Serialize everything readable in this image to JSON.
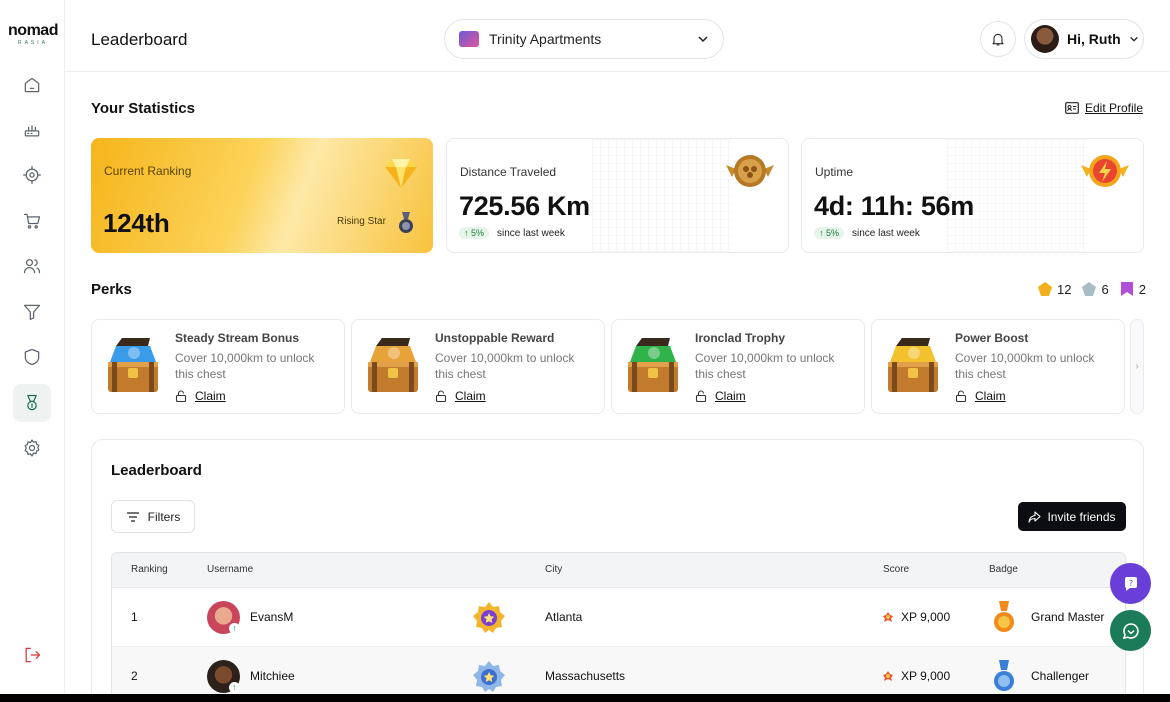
{
  "brand": {
    "logo_text": "nomad",
    "logo_sub": "RASIA"
  },
  "sidebar": {
    "items": [
      {
        "icon": "home-icon"
      },
      {
        "icon": "router-icon"
      },
      {
        "icon": "target-icon"
      },
      {
        "icon": "cart-icon"
      },
      {
        "icon": "users-icon"
      },
      {
        "icon": "funnel-icon"
      },
      {
        "icon": "shield-icon"
      },
      {
        "icon": "medal-icon",
        "active": true
      },
      {
        "icon": "gear-icon"
      }
    ],
    "logout_icon": "logout-icon"
  },
  "header": {
    "title": "Leaderboard",
    "property_name": "Trinity Apartments",
    "greeting": "Hi, Ruth"
  },
  "statistics": {
    "title": "Your Statistics",
    "edit_profile": "Edit Profile",
    "ranking": {
      "label": "Current Ranking",
      "value": "124th",
      "tier": "Rising Star"
    },
    "distance": {
      "label": "Distance Traveled",
      "value": "725.56 Km",
      "change": "↑ 5%",
      "since": "since last week"
    },
    "uptime": {
      "label": "Uptime",
      "value": "4d: 11h: 56m",
      "change": "↑ 5%",
      "since": "since last week"
    }
  },
  "perks": {
    "title": "Perks",
    "counts": {
      "gold": "12",
      "silver": "6",
      "purple": "2"
    },
    "items": [
      {
        "title": "Steady Stream Bonus",
        "desc": "Cover 10,000km to unlock this chest",
        "action": "Claim",
        "gem_color": "#3a9be8"
      },
      {
        "title": "Unstoppable Reward",
        "desc": "Cover 10,000km to unlock this chest",
        "action": "Claim",
        "gem_color": "#e8a23a"
      },
      {
        "title": "Ironclad Trophy",
        "desc": "Cover 10,000km to unlock this chest",
        "action": "Claim",
        "gem_color": "#2fb34a"
      },
      {
        "title": "Power Boost",
        "desc": "Cover 10,000km to unlock this chest",
        "action": "Claim",
        "gem_color": "#f2c12e"
      }
    ]
  },
  "leaderboard": {
    "title": "Leaderboard",
    "filters_label": "Filters",
    "invite_label": "Invite friends",
    "columns": [
      "Ranking",
      "Username",
      "City",
      "Score",
      "Badge"
    ],
    "rows": [
      {
        "rank": "1",
        "username": "EvansM",
        "city": "Atlanta",
        "score": "XP 9,000",
        "badge": "Grand Master"
      },
      {
        "rank": "2",
        "username": "Mitchiee",
        "city": "Massachusetts",
        "score": "XP 9,000",
        "badge": "Challenger"
      }
    ]
  },
  "colors": {
    "brand_green": "#1f6f52",
    "help_purple": "#6a3fd9",
    "chat_green": "#1b7a58",
    "rank_gold": "#f7bd2c"
  }
}
